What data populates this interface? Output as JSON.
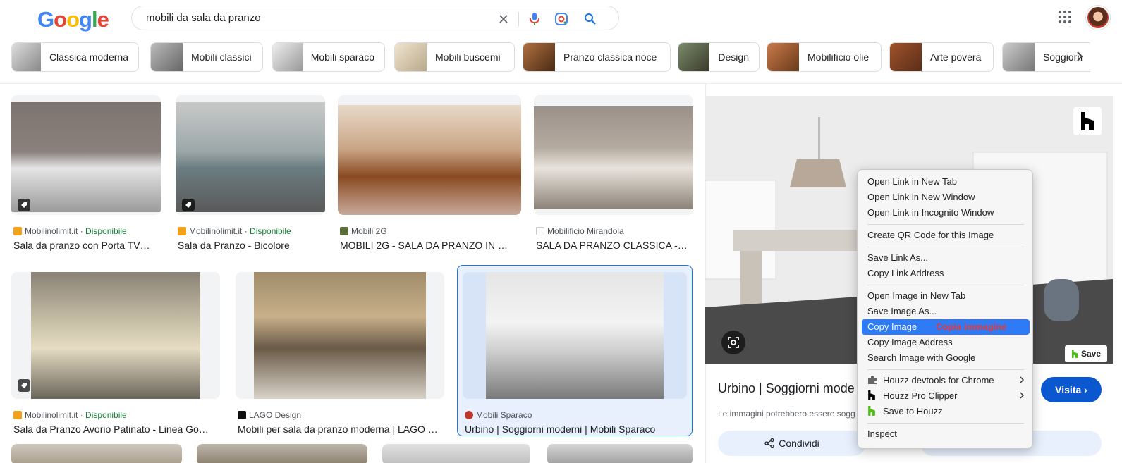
{
  "header": {
    "logo_letters": [
      "G",
      "o",
      "o",
      "g",
      "l",
      "e"
    ],
    "logo_colors": [
      "#4285f4",
      "#ea4335",
      "#fbbc05",
      "#4285f4",
      "#34a853",
      "#ea4335"
    ],
    "search_query": "mobili da sala da pranzo",
    "icons": [
      "close-icon",
      "mic-icon",
      "lens-icon",
      "search-icon",
      "apps-icon",
      "avatar"
    ]
  },
  "chips": [
    {
      "label": "Classica moderna"
    },
    {
      "label": "Mobili classici"
    },
    {
      "label": "Mobili sparaco"
    },
    {
      "label": "Mobili buscemi"
    },
    {
      "label": "Pranzo classica noce"
    },
    {
      "label": "Design"
    },
    {
      "label": "Mobilificio olie"
    },
    {
      "label": "Arte povera"
    },
    {
      "label": "Soggiorn"
    }
  ],
  "results": [
    {
      "source": "Mobilinolimit.it",
      "badge": "Disponibile",
      "title": "Sala da pranzo con Porta TV…"
    },
    {
      "source": "Mobilinolimit.it",
      "badge": "Disponibile",
      "title": "Sala da Pranzo - Bicolore"
    },
    {
      "source": "Mobili 2G",
      "badge": "",
      "title": "MOBILI 2G - SALA DA PRANZO IN …"
    },
    {
      "source": "Mobilificio Mirandola",
      "badge": "",
      "title": "SALA DA PRANZO CLASSICA -…"
    },
    {
      "source": "Mobilinolimit.it",
      "badge": "Disponibile",
      "title": "Sala da Pranzo Avorio Patinato - Linea Go…"
    },
    {
      "source": "LAGO Design",
      "badge": "",
      "title": "Mobili per sala da pranzo moderna | LAGO …"
    },
    {
      "source": "Mobili Sparaco",
      "badge": "",
      "title": "Urbino | Soggiorni moderni | Mobili Sparaco"
    }
  ],
  "panel": {
    "title": "Urbino | Soggiorni mode",
    "note": "Le immagini potrebbero essere sogg",
    "visit_label": "Visita ›",
    "share_label": "Condividi",
    "save_label": "Save"
  },
  "context_menu": {
    "items": [
      {
        "label": "Open Link in New Tab"
      },
      {
        "label": "Open Link in New Window"
      },
      {
        "label": "Open Link in Incognito Window"
      },
      {
        "label": "Create QR Code for this Image"
      },
      {
        "label": "Save Link As..."
      },
      {
        "label": "Copy Link Address"
      },
      {
        "label": "Open Image in New Tab"
      },
      {
        "label": "Save Image As..."
      },
      {
        "label": "Copy Image"
      },
      {
        "label": "Copy Image Address"
      },
      {
        "label": "Search Image with Google"
      },
      {
        "label": "Houzz devtools for Chrome"
      },
      {
        "label": "Houzz Pro Clipper"
      },
      {
        "label": "Save to Houzz"
      },
      {
        "label": "Inspect"
      }
    ],
    "highlighted_index": 8,
    "annotation": "Copia immagine"
  }
}
